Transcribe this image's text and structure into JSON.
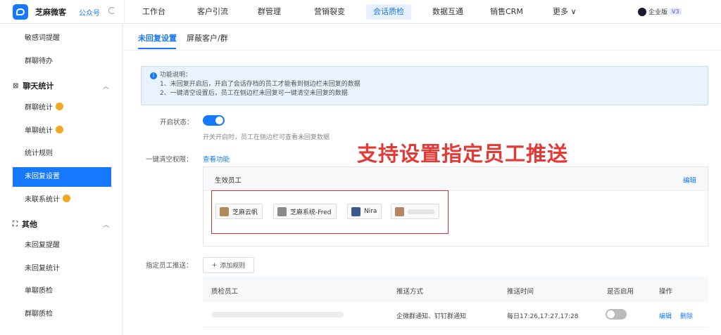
{
  "header": {
    "brand": "芝麻微客",
    "account_type": "公众号",
    "nav": [
      "工作台",
      "客户引流",
      "群管理",
      "营销裂变",
      "会话质检",
      "数据互通",
      "销售CRM",
      "更多 ∨"
    ],
    "active_nav": "会话质检",
    "edition": "企业版",
    "edition_level": "V3"
  },
  "sidebar": {
    "items_top": [
      "敏感词提醒",
      "群聊待办"
    ],
    "group1": "聊天统计",
    "group1_items": [
      "群聊统计",
      "单聊统计",
      "统计规则",
      "未回复设置",
      "未联系统计"
    ],
    "group2": "其他",
    "group2_items": [
      "未回复提醒",
      "未回复统计",
      "单聊质检",
      "群聊质检"
    ],
    "active_item": "未回复设置"
  },
  "tabs": [
    "未回复设置",
    "屏蔽客户/群"
  ],
  "info": {
    "title": "功能说明：",
    "line1": "1、未回复开启后，开启了会话存档的员工才能看到侧边栏未回复的数据",
    "line2": "2、一键清空设置后，员工在侧边栏未回复可一键清空未回复的数据"
  },
  "form": {
    "status_label": "开启状态：",
    "status_on": true,
    "status_hint": "开关开启时，员工在侧边栏可查看未回复数据",
    "clear_label": "一键清空权限：",
    "clear_link": "查看功能",
    "effective_title": "生效员工",
    "edit": "编辑",
    "staff": [
      "芝麻云帆",
      "芝麻系统-Fred",
      "Nira"
    ],
    "push_label": "指定员工推送：",
    "add_rule": "添加规则"
  },
  "annotation": "支持设置指定员工推送",
  "table": {
    "headers": [
      "质检员工",
      "推送方式",
      "推送时间",
      "是否启用",
      "操作"
    ],
    "row": {
      "method": "企微群通知、钉钉群通知",
      "time": "每日17:26,17:27,17:28",
      "enabled": false,
      "edit": "编辑",
      "delete": "删除"
    }
  },
  "colors": {
    "accent": "#1677ff",
    "annotation": "#e53935"
  }
}
